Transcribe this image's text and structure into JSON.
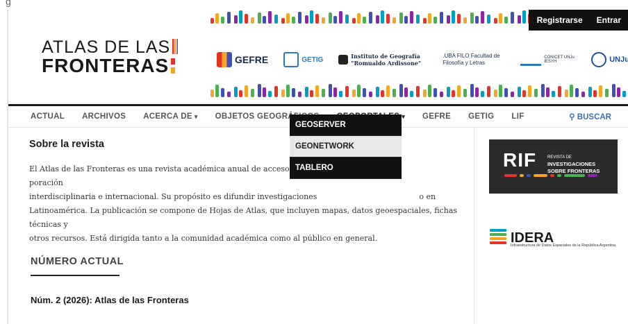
{
  "header": {
    "logo_line1": "ATLAS DE LAS",
    "logo_line2": "FRONTERAS",
    "auth": {
      "register": "Registrarse",
      "login": "Entrar"
    },
    "partners": [
      {
        "name": "GEFRE",
        "icon": "gefre-logo-icon"
      },
      {
        "name": "GETIG",
        "icon": "getig-logo-icon"
      },
      {
        "name": "Instituto de Geografía \"Romualdo Ardissone\"",
        "icon": "ig-logo-icon"
      },
      {
        "name": ".UBA FILO Facultad de Filosofía y Letras",
        "icon": "uba-filo-logo-icon"
      },
      {
        "name": "CONICET UNJu IESYH",
        "icon": "conicet-logo-icon"
      },
      {
        "name": "UNJu",
        "icon": "unju-logo-icon"
      }
    ],
    "brand_colors": [
      "#e5332a",
      "#f6a623",
      "#4caf50",
      "#3f51b5",
      "#8e24aa",
      "#00a0c6"
    ]
  },
  "nav": {
    "items": [
      "ACTUAL",
      "ARCHIVOS",
      "ACERCA DE",
      "OBJETOS GEOGRÁFICOS",
      "GEOPORTALES",
      "GEFRE",
      "GETIG",
      "LIF"
    ],
    "search": "BUSCAR"
  },
  "dropdown": {
    "items": [
      "GEOSERVER",
      "GEONETWORK",
      "TABLERO"
    ],
    "hovered": "GEONETWORK"
  },
  "main": {
    "title": "Sobre la revista",
    "body_l1a": "El Atlas de las Fronteras es una revista académica anual de acceso abierto y",
    "body_l1b": "poración",
    "body_l2a": "interdisciplinaria e internacional. Su propósito es difundir investigaciones",
    "body_l2b": "o en",
    "body_l3": "Latinoamérica. La publicación se compone de Hojas de Atlas, que incluyen mapas, datos geoespaciales, fichas técnicas y",
    "body_l4": "otros recursos. Está dirigida tanto a la comunidad académica como al público en general.",
    "section_title": "NÚMERO ACTUAL",
    "issue": "Núm. 2 (2026): Atlas de las Fronteras"
  },
  "sidebar": {
    "rif_big": "RIF",
    "rif_small1": "REVISTA DE",
    "rif_small2": "INVESTIGACIONES",
    "rif_small3": "SOBRE FRONTERAS",
    "idera_name": "IDERA",
    "idera_sub": "Infraestructura de Datos Espaciales de la República Argentina"
  }
}
